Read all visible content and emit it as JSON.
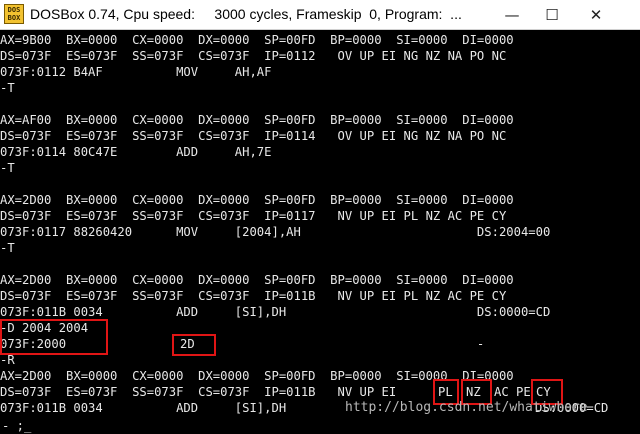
{
  "window": {
    "icon_text": "DOS BOX",
    "title": "DOSBox 0.74, Cpu speed:     3000 cycles, Frameskip  0, Program:  ...",
    "minimize": "—",
    "maximize": "☐",
    "close": "✕"
  },
  "console": {
    "lines": [
      "AX=9B00  BX=0000  CX=0000  DX=0000  SP=00FD  BP=0000  SI=0000  DI=0000",
      "DS=073F  ES=073F  SS=073F  CS=073F  IP=0112   OV UP EI NG NZ NA PO NC",
      "073F:0112 B4AF          MOV     AH,AF",
      "-T",
      "",
      "AX=AF00  BX=0000  CX=0000  DX=0000  SP=00FD  BP=0000  SI=0000  DI=0000",
      "DS=073F  ES=073F  SS=073F  CS=073F  IP=0114   OV UP EI NG NZ NA PO NC",
      "073F:0114 80C47E        ADD     AH,7E",
      "-T",
      "",
      "AX=2D00  BX=0000  CX=0000  DX=0000  SP=00FD  BP=0000  SI=0000  DI=0000",
      "DS=073F  ES=073F  SS=073F  CS=073F  IP=0117   NV UP EI PL NZ AC PE CY",
      "073F:0117 88260420      MOV     [2004],AH                        DS:2004=00",
      "-T",
      "",
      "AX=2D00  BX=0000  CX=0000  DX=0000  SP=00FD  BP=0000  SI=0000  DI=0000",
      "DS=073F  ES=073F  SS=073F  CS=073F  IP=011B   NV UP EI PL NZ AC PE CY",
      "073F:011B 0034          ADD     [SI],DH                          DS:0000=CD",
      "-D 2004 2004",
      "073F:2000                                                        -",
      "-R",
      "AX=2D00  BX=0000  CX=0000  DX=0000  SP=00FD  BP=0000  SI=0000  DI=0000",
      "DS=073F  ES=073F  SS=073F  CS=073F  IP=011B   NV UP EI",
      "073F:011B 0034          ADD     [SI],DH"
    ],
    "dump_value": "2D",
    "flag_pl": "PL",
    "flag_nz": "NZ",
    "flag_ac_rest": "AC PE",
    "flag_cy": "CY",
    "ds_value": "DS:0000=CD",
    "prompt": "- ;_"
  },
  "watermark": "http://blog.csdn.net/whatiwhere",
  "highlight_color": "#e01515"
}
